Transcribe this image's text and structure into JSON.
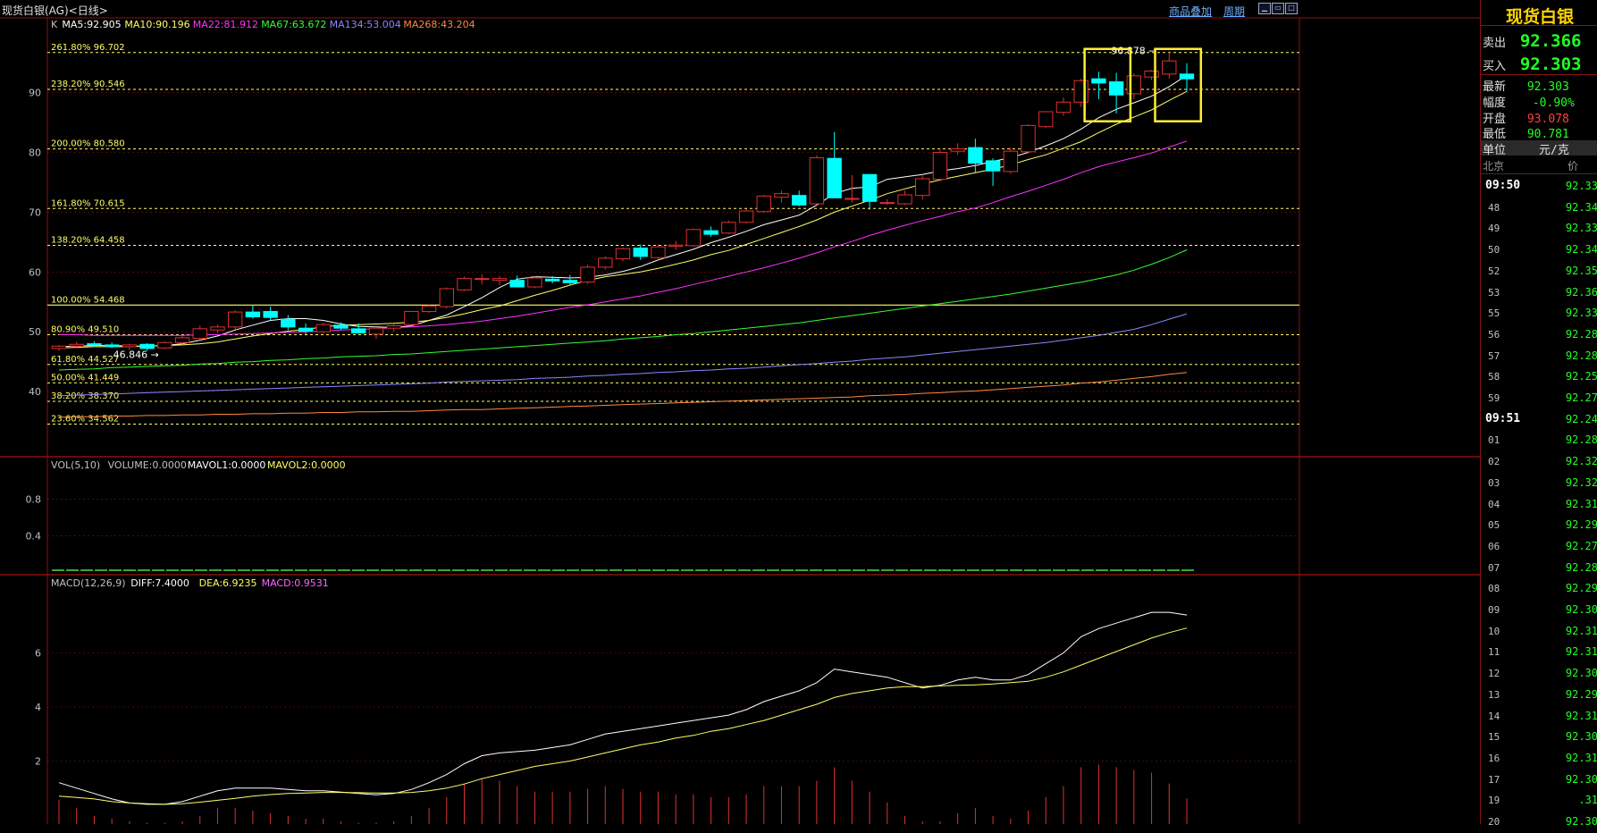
{
  "header": {
    "title": "现货白银(AG)<日线>",
    "overlay_link": "商品叠加",
    "period_link": "周期"
  },
  "indicators": {
    "ma_line": [
      {
        "text": "K",
        "color": "#c0c0c0"
      },
      {
        "text": "MA5:92.905",
        "color": "#ffffff"
      },
      {
        "text": "MA10:90.196",
        "color": "#ffff66"
      },
      {
        "text": "MA22:81.912",
        "color": "#ff33ff"
      },
      {
        "text": "MA67:63.672",
        "color": "#33ff33"
      },
      {
        "text": "MA134:53.004",
        "color": "#8888ff"
      },
      {
        "text": "MA268:43.204",
        "color": "#ff8844"
      }
    ],
    "vol_line": [
      {
        "text": "VOL(5,10)",
        "color": "#c0c0c0"
      },
      {
        "text": "VOLUME:0.0000",
        "color": "#c0c0c0"
      },
      {
        "text": "MAVOL1:0.0000",
        "color": "#ffffff"
      },
      {
        "text": "MAVOL2:0.0000",
        "color": "#ffff66"
      }
    ],
    "macd_line": [
      {
        "text": "MACD(12,26,9)",
        "color": "#c0c0c0"
      },
      {
        "text": "DIFF:7.4000",
        "color": "#ffffff"
      },
      {
        "text": "DEA:6.9235",
        "color": "#ffff66"
      },
      {
        "text": "MACD:0.9531",
        "color": "#ff66ff"
      }
    ]
  },
  "chart_data": {
    "type": "candlestick",
    "y_ticks": [
      40,
      50,
      60,
      70,
      80,
      90
    ],
    "ylim": [
      30,
      101
    ],
    "fib_levels": [
      {
        "label": "261.80% 96.702",
        "value": 96.702
      },
      {
        "label": "238.20% 90.546",
        "value": 90.546
      },
      {
        "label": "200.00% 80.580",
        "value": 80.58
      },
      {
        "label": "161.80% 70.615",
        "value": 70.615
      },
      {
        "label": "138.20% 64.458",
        "value": 64.458
      },
      {
        "label": "100.00% 54.468",
        "value": 54.468
      },
      {
        "label": "80.90% 49.510",
        "value": 49.51
      },
      {
        "label": "61.80% 44.527",
        "value": 44.527
      },
      {
        "label": "50.00% 41.449",
        "value": 41.449
      },
      {
        "label": "38.20% 38.370",
        "value": 38.37
      },
      {
        "label": "23.60% 34.562",
        "value": 34.562
      }
    ],
    "annotations": {
      "high": "96.878",
      "low": "46.846"
    },
    "candles": [
      [
        47.2,
        47.8,
        46.8,
        47.6
      ],
      [
        47.6,
        48.3,
        47.2,
        47.9
      ],
      [
        48,
        48.4,
        47.5,
        47.8
      ],
      [
        47.8,
        48.2,
        47.3,
        47.5
      ],
      [
        47.5,
        48,
        46.9,
        47.8
      ],
      [
        47.9,
        48.1,
        46.8,
        47.2
      ],
      [
        47.3,
        48.4,
        47.1,
        48.2
      ],
      [
        48.2,
        49.3,
        47.9,
        49
      ],
      [
        48.9,
        51,
        48.6,
        50.5
      ],
      [
        50.3,
        51.2,
        49.8,
        50.8
      ],
      [
        50.8,
        53.6,
        50.4,
        53.3
      ],
      [
        53.3,
        54.4,
        52.2,
        52.5
      ],
      [
        53.4,
        54.2,
        51.9,
        52.4
      ],
      [
        52.1,
        52.8,
        50.3,
        50.8
      ],
      [
        50.6,
        51.4,
        49.6,
        50.1
      ],
      [
        50,
        51.5,
        49.7,
        51.2
      ],
      [
        51.1,
        51.6,
        50.3,
        50.6
      ],
      [
        50.5,
        51.4,
        49.7,
        49.8
      ],
      [
        49.6,
        50.8,
        48.8,
        50.6
      ],
      [
        50.6,
        51.3,
        50,
        51
      ],
      [
        51.2,
        53.5,
        51,
        53.4
      ],
      [
        53.4,
        54.6,
        53.1,
        54.3
      ],
      [
        54.2,
        57.4,
        53.9,
        57.2
      ],
      [
        57,
        59.2,
        56.8,
        58.9
      ],
      [
        58.8,
        59.6,
        57.9,
        58.9
      ],
      [
        58.6,
        59.3,
        57.8,
        58.9
      ],
      [
        58.6,
        59.4,
        57.6,
        57.5
      ],
      [
        57.5,
        59.3,
        57.3,
        59
      ],
      [
        58.8,
        59.3,
        58.1,
        58.5
      ],
      [
        58.6,
        59.5,
        57.9,
        58.2
      ],
      [
        58.3,
        61.2,
        58,
        60.8
      ],
      [
        60.8,
        62.6,
        60.4,
        62.3
      ],
      [
        62.2,
        64.1,
        61.8,
        63.9
      ],
      [
        64,
        64.6,
        62,
        62.6
      ],
      [
        62.4,
        64.6,
        62,
        64.2
      ],
      [
        64.3,
        65.2,
        63.7,
        64.5
      ],
      [
        64.4,
        67.3,
        64.2,
        67.1
      ],
      [
        66.9,
        67.6,
        65.9,
        66.3
      ],
      [
        66.5,
        68.6,
        66.3,
        68.3
      ],
      [
        68.3,
        70.5,
        68.1,
        70.2
      ],
      [
        70.1,
        72.9,
        69.9,
        72.7
      ],
      [
        72.5,
        73.6,
        71.6,
        73.1
      ],
      [
        72.8,
        73.6,
        71,
        71.2
      ],
      [
        71.4,
        79.5,
        71.2,
        79.1
      ],
      [
        79,
        83.4,
        72.4,
        72.4
      ],
      [
        72.3,
        76.2,
        71.6,
        72.3
      ],
      [
        76.3,
        76.3,
        70.4,
        71.8
      ],
      [
        71.6,
        72.2,
        71.2,
        71.6
      ],
      [
        71.4,
        73.6,
        71.2,
        72.9
      ],
      [
        72.8,
        76.1,
        72.1,
        75.6
      ],
      [
        75.5,
        80.4,
        75.1,
        80
      ],
      [
        80.2,
        81.5,
        79.6,
        80.6
      ],
      [
        80.8,
        82.3,
        76.6,
        78.2
      ],
      [
        78.6,
        79,
        74.4,
        76.9
      ],
      [
        76.8,
        80.8,
        76.4,
        80.2
      ],
      [
        80.1,
        84.7,
        79.8,
        84.5
      ],
      [
        84.3,
        86.9,
        84.1,
        86.8
      ],
      [
        86.7,
        89.2,
        86.1,
        88.4
      ],
      [
        88.4,
        92.3,
        87.6,
        92
      ],
      [
        92.3,
        93.5,
        88.9,
        91.6
      ],
      [
        91.8,
        93.3,
        86.5,
        89.6
      ],
      [
        89.8,
        93.2,
        88.9,
        92.8
      ],
      [
        92.6,
        93.8,
        92.1,
        93.6
      ],
      [
        93.1,
        96.9,
        92.3,
        95.3
      ],
      [
        93.1,
        94.9,
        90.2,
        92.3
      ]
    ],
    "ma_series": {
      "ma5": [
        47.5,
        47.6,
        47.7,
        47.7,
        47.6,
        47.6,
        47.7,
        48,
        48.6,
        49.3,
        50.3,
        51.1,
        51.9,
        52.2,
        52.2,
        51.9,
        51.3,
        50.9,
        50.8,
        50.7,
        51,
        51.9,
        52.8,
        54.2,
        55.7,
        57.4,
        58.8,
        59.2,
        59.1,
        59,
        59.1,
        59.5,
        60.1,
        60.9,
        62,
        62.9,
        63.8,
        64.9,
        65.8,
        66.8,
        67.9,
        68.7,
        69.5,
        71.2,
        73.1,
        74,
        74.2,
        75.5,
        75.9,
        76.3,
        76.9,
        77.3,
        77.8,
        78.5,
        79.1,
        80,
        81.1,
        82.3,
        83.9,
        85.8,
        87.2,
        88.3,
        89.4,
        91,
        92.9
      ],
      "ma10": [
        47.3,
        47.4,
        47.5,
        47.5,
        47.5,
        47.6,
        47.7,
        47.8,
        48,
        48.3,
        48.8,
        49.3,
        49.7,
        50.1,
        50.4,
        50.8,
        51.1,
        51.2,
        51.3,
        51.4,
        51.6,
        51.9,
        52.4,
        53,
        53.7,
        54.3,
        55.2,
        56.1,
        56.9,
        57.8,
        58.6,
        59.2,
        59.6,
        60,
        60.6,
        61.3,
        62,
        62.9,
        63.6,
        64.6,
        65.6,
        66.6,
        67.6,
        68.7,
        70,
        71,
        72,
        73.1,
        73.9,
        74.7,
        75.4,
        76,
        76.6,
        77.2,
        77.9,
        78.8,
        79.6,
        80.7,
        81.8,
        83.3,
        84.7,
        85.9,
        87.1,
        88.7,
        90.2
      ],
      "ma22": [
        49.5,
        49.5,
        49.4,
        49.4,
        49.4,
        49.4,
        49.4,
        49.4,
        49.5,
        49.5,
        49.6,
        49.7,
        49.8,
        49.9,
        50,
        50.1,
        50.3,
        50.4,
        50.5,
        50.7,
        50.8,
        51,
        51.2,
        51.5,
        51.8,
        52.2,
        52.6,
        53.1,
        53.6,
        54.1,
        54.5,
        55,
        55.5,
        56,
        56.6,
        57.2,
        57.9,
        58.6,
        59.3,
        60,
        60.7,
        61.5,
        62.3,
        63.2,
        64.2,
        65.1,
        66.1,
        67,
        67.8,
        68.6,
        69.3,
        70.1,
        70.7,
        71.6,
        72.6,
        73.5,
        74.5,
        75.5,
        76.6,
        77.6,
        78.4,
        79.1,
        79.9,
        80.9,
        81.9
      ],
      "ma67": [
        43.6,
        43.7,
        43.8,
        44,
        44.1,
        44.2,
        44.3,
        44.4,
        44.6,
        44.7,
        44.9,
        45,
        45.2,
        45.3,
        45.5,
        45.6,
        45.8,
        45.9,
        46,
        46.2,
        46.3,
        46.5,
        46.7,
        46.9,
        47.1,
        47.3,
        47.5,
        47.7,
        47.9,
        48.1,
        48.3,
        48.5,
        48.8,
        49,
        49.2,
        49.5,
        49.7,
        50,
        50.3,
        50.6,
        50.9,
        51.2,
        51.5,
        51.9,
        52.3,
        52.7,
        53.1,
        53.5,
        53.9,
        54.3,
        54.7,
        55.1,
        55.5,
        55.9,
        56.3,
        56.8,
        57.3,
        57.8,
        58.3,
        58.9,
        59.5,
        60.3,
        61.3,
        62.4,
        63.7
      ],
      "ma134": [
        39.3,
        39.4,
        39.5,
        39.6,
        39.7,
        39.8,
        39.9,
        40,
        40.1,
        40.2,
        40.3,
        40.4,
        40.5,
        40.6,
        40.7,
        40.8,
        40.9,
        41,
        41.1,
        41.2,
        41.3,
        41.4,
        41.6,
        41.7,
        41.8,
        41.9,
        42,
        42.2,
        42.3,
        42.4,
        42.6,
        42.7,
        42.9,
        43,
        43.2,
        43.3,
        43.5,
        43.6,
        43.8,
        43.9,
        44.1,
        44.3,
        44.5,
        44.7,
        44.9,
        45.1,
        45.4,
        45.6,
        45.8,
        46.1,
        46.4,
        46.7,
        47,
        47.3,
        47.6,
        47.9,
        48.2,
        48.6,
        49,
        49.4,
        49.9,
        50.4,
        51.2,
        52.1,
        53
      ],
      "ma268": [
        35.7,
        35.8,
        35.8,
        35.9,
        35.9,
        36,
        36,
        36.1,
        36.1,
        36.2,
        36.2,
        36.3,
        36.3,
        36.4,
        36.4,
        36.5,
        36.5,
        36.6,
        36.6,
        36.7,
        36.7,
        36.8,
        36.9,
        37,
        37,
        37.1,
        37.2,
        37.3,
        37.4,
        37.5,
        37.6,
        37.7,
        37.8,
        37.9,
        38,
        38.1,
        38.2,
        38.3,
        38.4,
        38.5,
        38.6,
        38.7,
        38.8,
        38.9,
        39,
        39.1,
        39.3,
        39.4,
        39.5,
        39.7,
        39.8,
        40,
        40.1,
        40.3,
        40.5,
        40.7,
        40.9,
        41.1,
        41.4,
        41.6,
        41.9,
        42.2,
        42.5,
        42.9,
        43.2
      ]
    },
    "volume": {
      "y_ticks": [
        0.4,
        0.8
      ],
      "ylim": [
        0,
        1.1
      ]
    },
    "macd": {
      "y_ticks": [
        2,
        4,
        6
      ],
      "ylim": [
        0,
        8
      ],
      "diff": [
        1.2,
        1,
        0.8,
        0.6,
        0.45,
        0.4,
        0.4,
        0.5,
        0.7,
        0.9,
        1,
        1,
        1,
        0.95,
        0.9,
        0.9,
        0.85,
        0.8,
        0.75,
        0.8,
        0.95,
        1.2,
        1.5,
        1.9,
        2.2,
        2.3,
        2.35,
        2.4,
        2.5,
        2.6,
        2.8,
        3,
        3.1,
        3.2,
        3.3,
        3.4,
        3.5,
        3.6,
        3.7,
        3.9,
        4.2,
        4.4,
        4.6,
        4.9,
        5.4,
        5.3,
        5.2,
        5.1,
        4.9,
        4.7,
        4.8,
        5,
        5.1,
        5,
        5,
        5.2,
        5.6,
        6,
        6.6,
        6.9,
        7.1,
        7.3,
        7.5,
        7.5,
        7.4
      ],
      "dea": [
        0.7,
        0.65,
        0.6,
        0.5,
        0.45,
        0.42,
        0.4,
        0.42,
        0.48,
        0.55,
        0.62,
        0.7,
        0.76,
        0.8,
        0.82,
        0.84,
        0.84,
        0.83,
        0.82,
        0.82,
        0.84,
        0.9,
        1,
        1.15,
        1.35,
        1.5,
        1.65,
        1.8,
        1.9,
        2,
        2.15,
        2.3,
        2.45,
        2.6,
        2.7,
        2.85,
        2.95,
        3.1,
        3.2,
        3.35,
        3.5,
        3.7,
        3.9,
        4.1,
        4.35,
        4.5,
        4.6,
        4.7,
        4.75,
        4.75,
        4.78,
        4.8,
        4.82,
        4.85,
        4.9,
        4.95,
        5.1,
        5.3,
        5.55,
        5.8,
        6.05,
        6.3,
        6.55,
        6.75,
        6.92
      ],
      "hist": [
        0.9,
        0.6,
        0.3,
        0.2,
        0.1,
        0.05,
        0.05,
        0.1,
        0.3,
        0.6,
        0.6,
        0.5,
        0.4,
        0.3,
        0.2,
        0.2,
        0.1,
        0.05,
        0.05,
        0.1,
        0.3,
        0.6,
        1,
        1.5,
        1.7,
        1.6,
        1.4,
        1.2,
        1.2,
        1.2,
        1.3,
        1.4,
        1.3,
        1.2,
        1.2,
        1.1,
        1.1,
        1,
        1,
        1.1,
        1.4,
        1.4,
        1.4,
        1.6,
        2.1,
        1.6,
        1.2,
        0.8,
        0.3,
        0.1,
        0.1,
        0.4,
        0.6,
        0.3,
        0.2,
        0.5,
        1,
        1.4,
        2.1,
        2.2,
        2.1,
        2,
        1.9,
        1.5,
        0.95
      ]
    }
  },
  "quote_panel": {
    "title": "现货白银",
    "sell_label": "卖出",
    "sell_value": "92.366",
    "buy_label": "买入",
    "buy_value": "92.303",
    "latest_label": "最新",
    "latest_value": "92.303",
    "change_label": "幅度",
    "change_value": "-0.90%",
    "open_label": "开盘",
    "open_value": "93.078",
    "low_label": "最低",
    "low_value": "90.781",
    "unit_label": "单位",
    "unit_value": "元/克",
    "city_label": "北京",
    "price_col_label": "价",
    "ticks": [
      {
        "time": "09:50",
        "price": "92.33",
        "bold": true
      },
      {
        "time": "48",
        "price": "92.34"
      },
      {
        "time": "49",
        "price": "92.33"
      },
      {
        "time": "50",
        "price": "92.34"
      },
      {
        "time": "52",
        "price": "92.35"
      },
      {
        "time": "53",
        "price": "92.36"
      },
      {
        "time": "55",
        "price": "92.33"
      },
      {
        "time": "56",
        "price": "92.28"
      },
      {
        "time": "57",
        "price": "92.28"
      },
      {
        "time": "58",
        "price": "92.25"
      },
      {
        "time": "59",
        "price": "92.27"
      },
      {
        "time": "09:51",
        "price": "92.24",
        "bold": true
      },
      {
        "time": "01",
        "price": "92.28"
      },
      {
        "time": "02",
        "price": "92.32"
      },
      {
        "time": "03",
        "price": "92.32"
      },
      {
        "time": "04",
        "price": "92.31"
      },
      {
        "time": "05",
        "price": "92.29"
      },
      {
        "time": "06",
        "price": "92.27"
      },
      {
        "time": "07",
        "price": "92.28"
      },
      {
        "time": "08",
        "price": "92.29"
      },
      {
        "time": "09",
        "price": "92.30"
      },
      {
        "time": "10",
        "price": "92.31"
      },
      {
        "time": "11",
        "price": "92.31"
      },
      {
        "time": "12",
        "price": "92.30"
      },
      {
        "time": "13",
        "price": "92.29"
      },
      {
        "time": "14",
        "price": "92.31"
      },
      {
        "time": "15",
        "price": "92.30"
      },
      {
        "time": "16",
        "price": "92.31"
      },
      {
        "time": "17",
        "price": "92.30"
      },
      {
        "time": "19",
        "price": ".31"
      },
      {
        "time": "20",
        "price": "92.30"
      }
    ]
  },
  "colors": {
    "up": "#e03030",
    "down": "#00ffff",
    "grid": "#8a1010",
    "fib": "#ffff66",
    "highlight_box": "#ffee33"
  }
}
